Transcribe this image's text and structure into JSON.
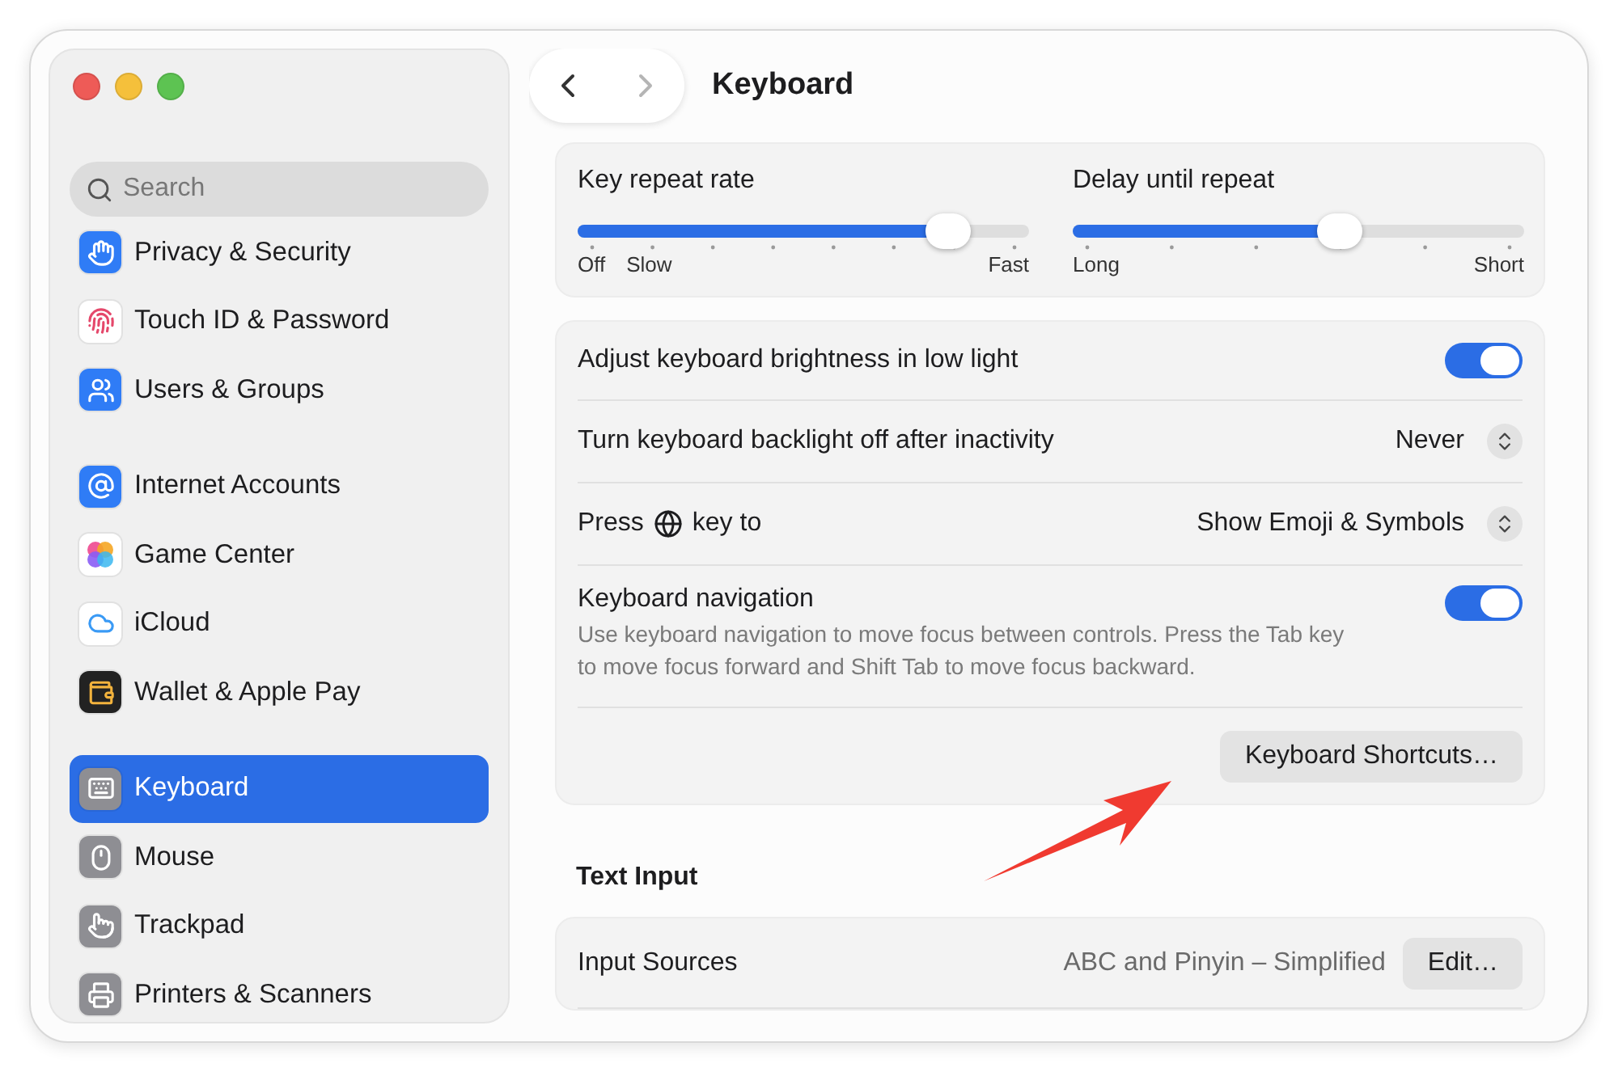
{
  "sidebar": {
    "search": {
      "placeholder": "Search"
    },
    "groups": [
      {
        "items": [
          {
            "label": "Privacy & Security",
            "selected": false
          },
          {
            "label": "Touch ID & Password",
            "selected": false
          },
          {
            "label": "Users & Groups",
            "selected": false
          }
        ]
      },
      {
        "items": [
          {
            "label": "Internet Accounts",
            "selected": false
          },
          {
            "label": "Game Center",
            "selected": false
          },
          {
            "label": "iCloud",
            "selected": false
          },
          {
            "label": "Wallet & Apple Pay",
            "selected": false
          }
        ]
      },
      {
        "items": [
          {
            "label": "Keyboard",
            "selected": true
          },
          {
            "label": "Mouse",
            "selected": false
          },
          {
            "label": "Trackpad",
            "selected": false
          },
          {
            "label": "Printers & Scanners",
            "selected": false
          }
        ]
      }
    ]
  },
  "header": {
    "title": "Keyboard",
    "back_disabled": false,
    "forward_disabled": true
  },
  "sliders": [
    {
      "label": "Key repeat rate",
      "level": 0.82,
      "min_labels": [
        "Off",
        "Slow"
      ],
      "max_label": "Fast"
    },
    {
      "label": "Delay until repeat",
      "level": 0.59,
      "min_labels": [
        "Long"
      ],
      "max_label": "Short"
    }
  ],
  "settings": [
    {
      "kind": "toggle",
      "label": "Adjust keyboard brightness in low light",
      "on": true
    },
    {
      "kind": "popup",
      "label": "Turn keyboard backlight off after inactivity",
      "value": "Never"
    },
    {
      "kind": "globe-popup",
      "label_before": "Press",
      "label_after": "key to",
      "value": "Show Emoji & Symbols"
    },
    {
      "kind": "toggle",
      "label": "Keyboard navigation",
      "description": "Use keyboard navigation to move focus between controls. Press the Tab key to move focus forward and Shift Tab to move focus backward.",
      "on": true
    },
    {
      "kind": "button",
      "label": "Keyboard Shortcuts…"
    }
  ],
  "text_input": {
    "heading": "Text Input",
    "rows": [
      {
        "label": "Input Sources",
        "value": "ABC and Pinyin – Simplified",
        "button": "Edit…"
      }
    ]
  }
}
